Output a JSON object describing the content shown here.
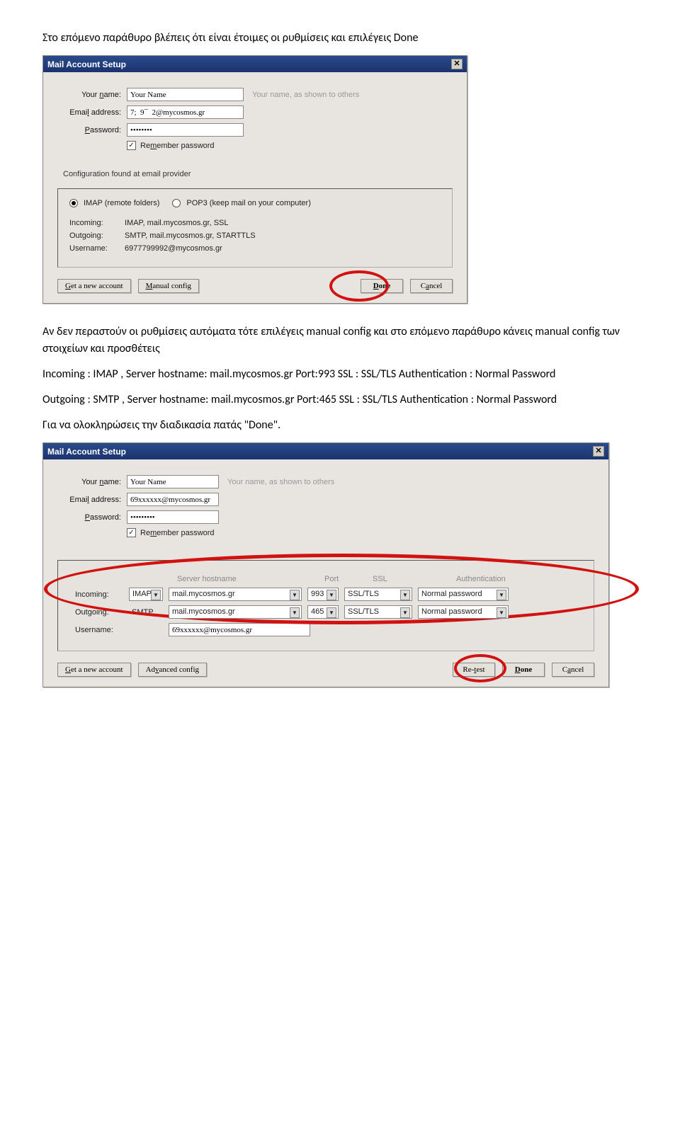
{
  "intro_para": "Στο επόμενο παράθυρο βλέπεις ότι είναι έτοιμες οι ρυθμίσεις και επιλέγεις Done",
  "dialog1": {
    "title": "Mail Account Setup",
    "labels": {
      "your_name": "Your name:",
      "email": "Email address:",
      "password": "Password:"
    },
    "values": {
      "your_name": "Your Name",
      "email": "7;  9¯  2@mycosmos.gr",
      "password": "••••••••",
      "remember_checked": "✓",
      "remember_label": "Remember password"
    },
    "hint": "Your name, as shown to others",
    "config_msg": "Configuration found at email provider",
    "radio": {
      "imap": "IMAP (remote folders)",
      "pop3": "POP3 (keep mail on your computer)"
    },
    "rows": {
      "incoming_k": "Incoming:",
      "incoming_v": "IMAP, mail.mycosmos.gr, SSL",
      "outgoing_k": "Outgoing:",
      "outgoing_v": "SMTP, mail.mycosmos.gr, STARTTLS",
      "username_k": "Username:",
      "username_v": "6977799992@mycosmos.gr"
    },
    "buttons": {
      "getnew": "Get a new account",
      "manual": "Manual config",
      "done": "Done",
      "cancel": "Cancel"
    }
  },
  "mid_para1": "Αν  δεν περαστούν οι ρυθμίσεις αυτόματα τότε επιλέγεις manual config και στο επόμενο παράθυρο κάνεις manual config των στοιχείων και προσθέτεις",
  "mid_para2": "Incoming : IMAP , Server hostname: mail.mycosmos.gr Port:993 SSL : SSL/TLS Authentication : Normal Password",
  "mid_para3": "Outgoing : SMTP , Server hostname: mail.mycosmos.gr Port:465 SSL : SSL/TLS Authentication : Normal Password",
  "mid_para4": "Για να ολοκληρώσεις την διαδικασία πατάς \"Done\".",
  "dialog2": {
    "title": "Mail Account Setup",
    "labels": {
      "your_name": "Your name:",
      "email": "Email address:",
      "password": "Password:"
    },
    "values": {
      "your_name": "Your Name",
      "email": "69xxxxxx@mycosmos.gr",
      "password": "•••••••••",
      "remember_checked": "✓",
      "remember_label": "Remember password"
    },
    "hint": "Your name, as shown to others",
    "headers": {
      "server": "Server hostname",
      "port": "Port",
      "ssl": "SSL",
      "auth": "Authentication"
    },
    "incoming": {
      "label": "Incoming:",
      "proto": "IMAP",
      "host": "mail.mycosmos.gr",
      "port": "993",
      "ssl": "SSL/TLS",
      "auth": "Normal password"
    },
    "outgoing": {
      "label": "Outgoing:",
      "proto": "SMTP",
      "host": "mail.mycosmos.gr",
      "port": "465",
      "ssl": "SSL/TLS",
      "auth": "Normal password"
    },
    "username": {
      "label": "Username:",
      "value": "69xxxxxx@mycosmos.gr"
    },
    "buttons": {
      "getnew": "Get a new account",
      "advanced": "Advanced config",
      "retest": "Re-test",
      "done": "Done",
      "cancel": "Cancel"
    }
  }
}
